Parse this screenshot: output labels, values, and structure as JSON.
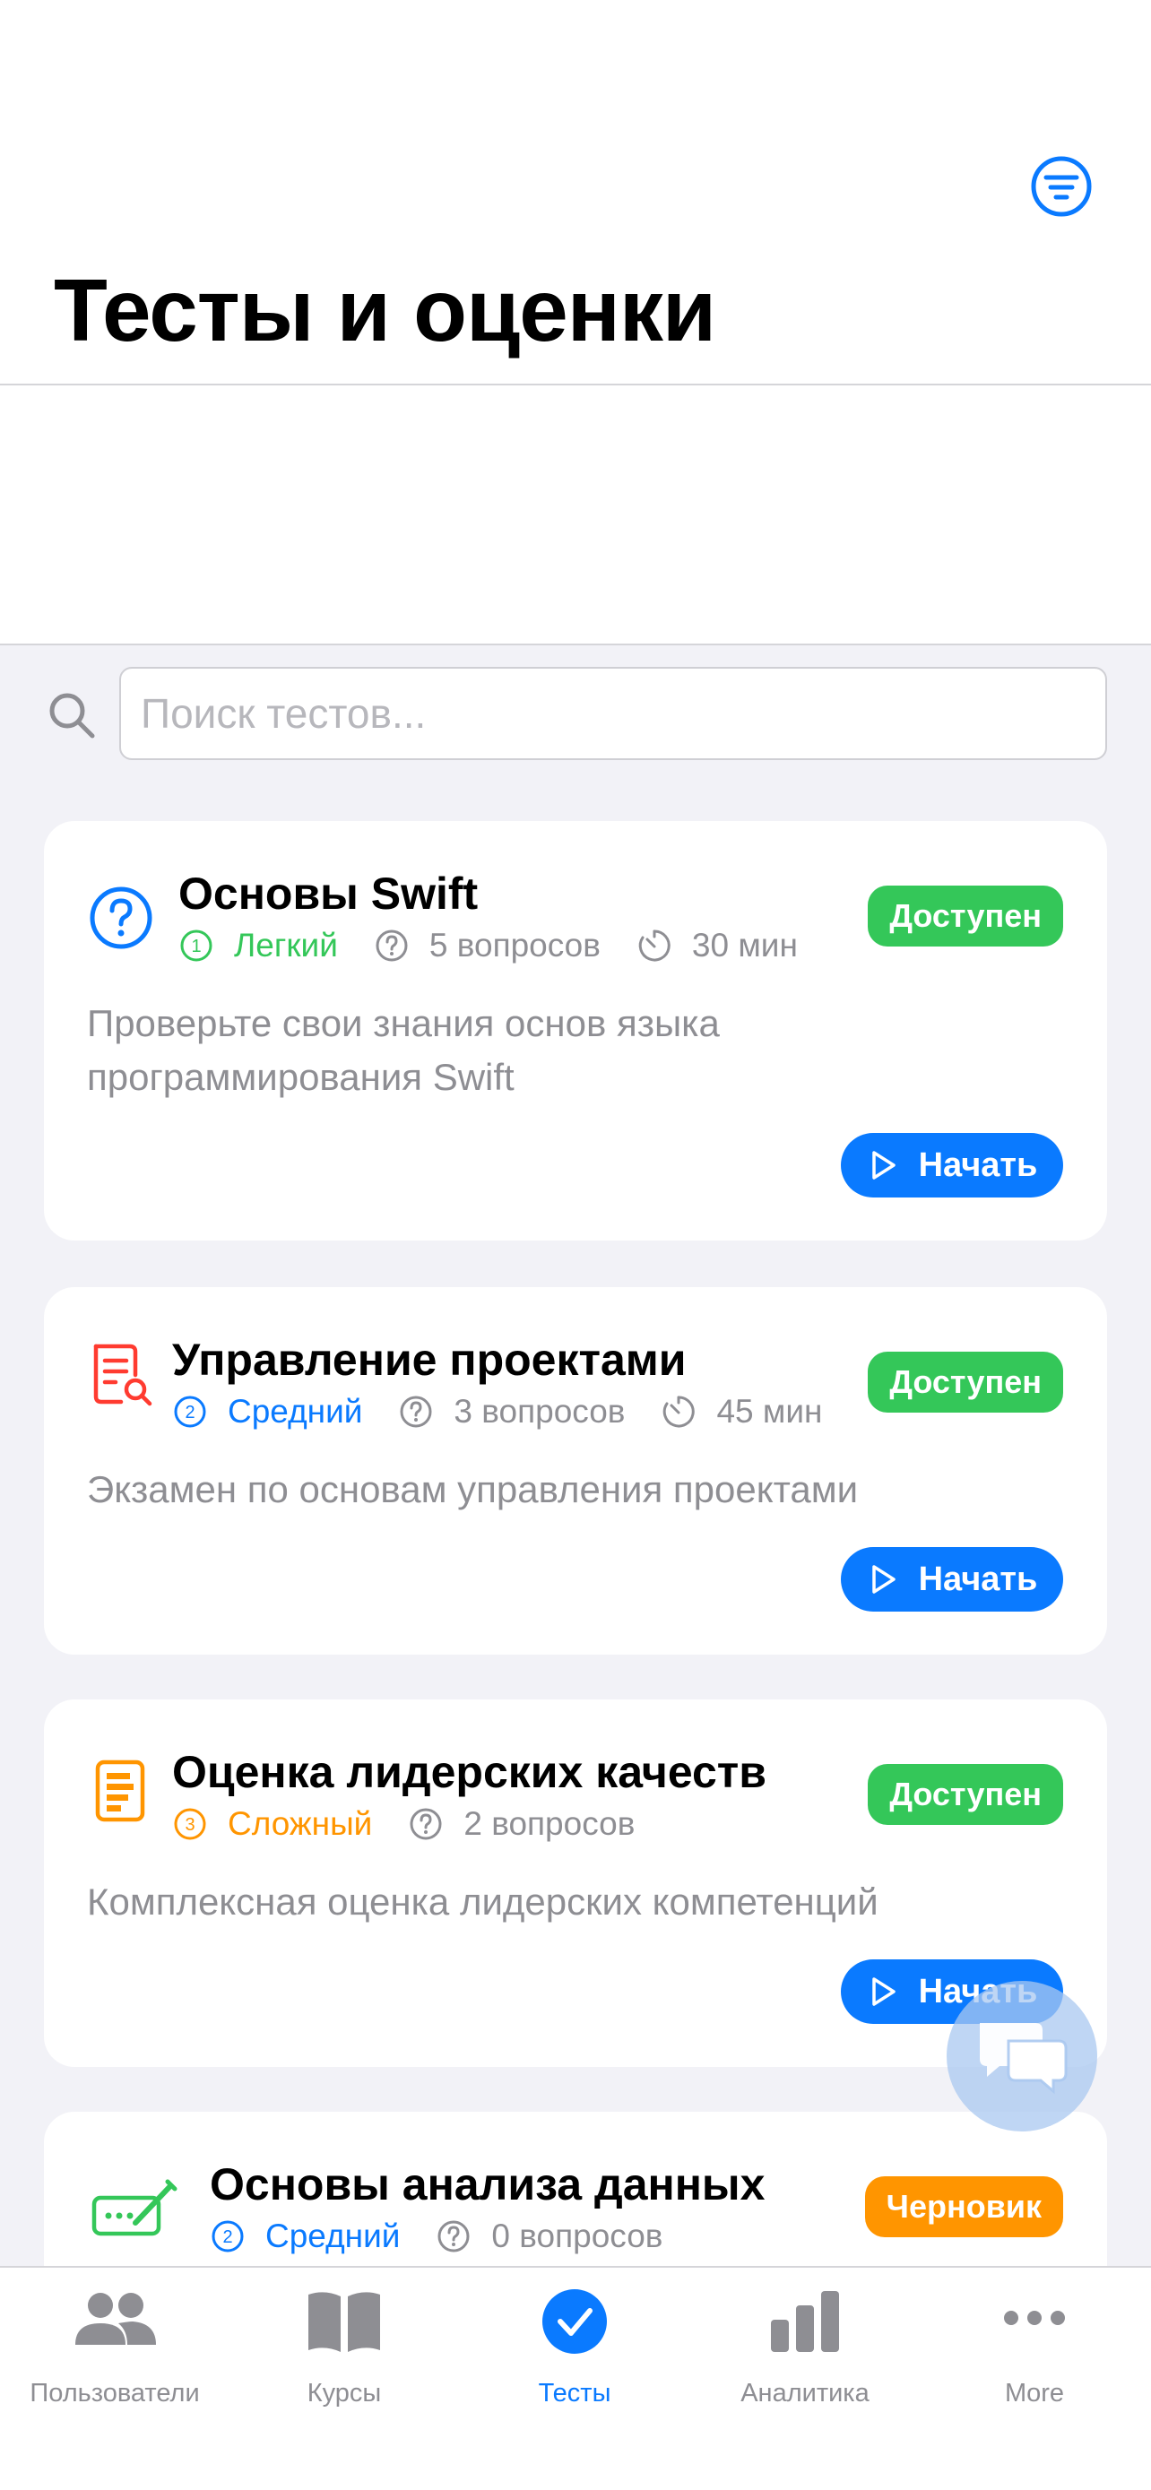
{
  "header": {
    "title": "Тесты и оценки",
    "filter_icon": "filter-circle-icon"
  },
  "search": {
    "placeholder": "Поиск тестов...",
    "value": ""
  },
  "tests": [
    {
      "icon": "question-circle-icon",
      "title": "Основы Swift",
      "difficulty_number": "1",
      "difficulty": "Легкий",
      "difficulty_color": "#34c759",
      "questions": "5 вопросов",
      "duration": "30 мин",
      "status": "Доступен",
      "status_color": "#34c759",
      "description": "Проверьте свои знания основ языка программирования Swift",
      "action": "Начать"
    },
    {
      "icon": "document-search-icon",
      "title": "Управление проектами",
      "difficulty_number": "2",
      "difficulty": "Средний",
      "difficulty_color": "#0a7aff",
      "questions": "3 вопросов",
      "duration": "45 мин",
      "status": "Доступен",
      "status_color": "#34c759",
      "description": "Экзамен по основам управления проектами",
      "action": "Начать"
    },
    {
      "icon": "document-list-icon",
      "title": "Оценка лидерских качеств",
      "difficulty_number": "3",
      "difficulty": "Сложный",
      "difficulty_color": "#ff9500",
      "questions": "2 вопросов",
      "duration": "",
      "status": "Доступен",
      "status_color": "#34c759",
      "description": "Комплексная оценка лидерских компетенций",
      "action": "Начать"
    },
    {
      "icon": "signature-pencil-icon",
      "title": "Основы анализа данных",
      "difficulty_number": "2",
      "difficulty": "Средний",
      "difficulty_color": "#0a7aff",
      "questions": "0 вопросов",
      "duration": "",
      "status": "Черновик",
      "status_color": "#ff9500",
      "description": "",
      "action": ""
    }
  ],
  "tabbar": {
    "active": "Тесты",
    "accent_color": "#0a7aff",
    "inactive_color": "#8e8e93",
    "items": [
      {
        "label": "Пользователи",
        "icon": "users-icon"
      },
      {
        "label": "Курсы",
        "icon": "book-icon"
      },
      {
        "label": "Тесты",
        "icon": "checkmark-circle-icon"
      },
      {
        "label": "Аналитика",
        "icon": "bar-chart-icon"
      },
      {
        "label": "More",
        "icon": "ellipsis-icon"
      }
    ]
  }
}
